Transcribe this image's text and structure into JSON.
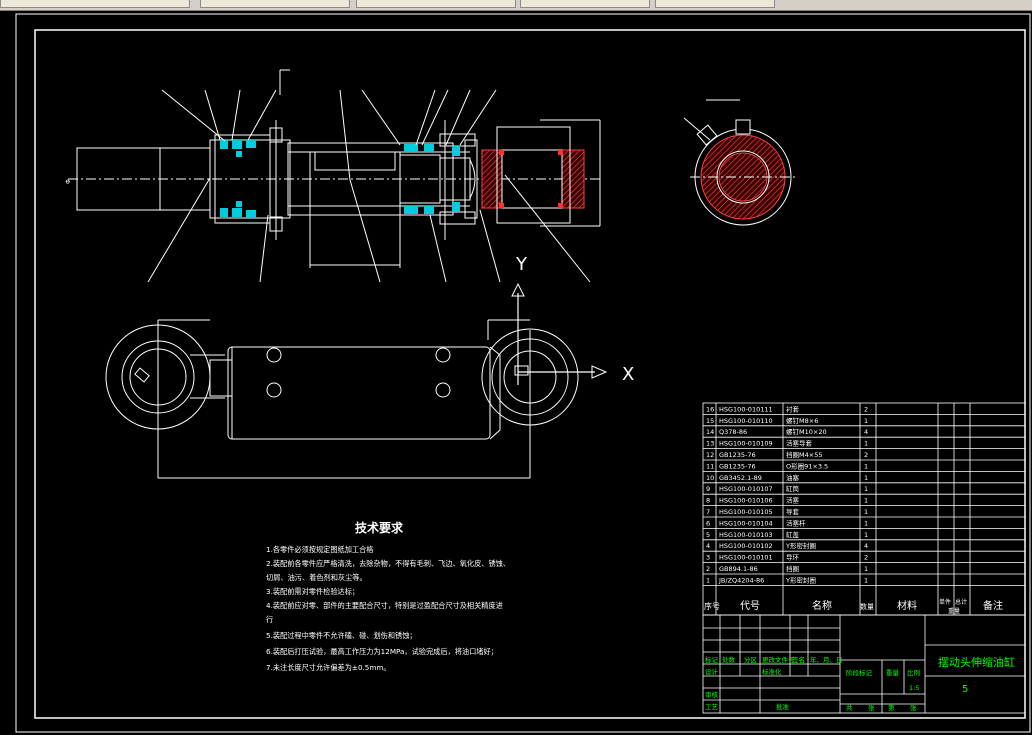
{
  "app": {
    "toolbar_tabs": [
      "",
      "",
      "",
      "",
      ""
    ]
  },
  "drawing": {
    "axis_y_label": "Y",
    "axis_x_label": "X",
    "tech_title": "技术要求",
    "tech_notes": [
      "1.各零件必须按规定图纸加工合格",
      "2.装配前各零件应严格清洗，去除杂物，不得有毛刺、飞边、氧化皮、锈蚀、",
      "  切屑、油污、着色剂和灰尘等。",
      "3.装配前需对零件检验达标；",
      "4.装配前应对零、部件的主要配合尺寸，特别是过盈配合尺寸及相关精度进",
      "  行",
      "5.装配过程中零件不允许磕、碰、划伤和锈蚀；",
      "6.装配后打压试验，最高工作压力为12MPa，试验完成后，将油口堵好；",
      "7.未注长度尺寸允许偏差为±0.5mm。"
    ],
    "bom_rows": [
      {
        "no": "16",
        "code": "HSG100-010111",
        "name": "衬套",
        "qty": "2"
      },
      {
        "no": "15",
        "code": "HSG100-010110",
        "name": "螺钉M8×6",
        "qty": "1"
      },
      {
        "no": "14",
        "code": "Q378-86",
        "name": "螺钉M10×20",
        "qty": "4"
      },
      {
        "no": "13",
        "code": "HSG100-010109",
        "name": "活塞导套",
        "qty": "1"
      },
      {
        "no": "12",
        "code": "GB1235-76",
        "name": "挡圈M4×55",
        "qty": "2"
      },
      {
        "no": "11",
        "code": "GB1235-76",
        "name": "O形圈91×3.5",
        "qty": "1"
      },
      {
        "no": "10",
        "code": "GB3452.1-89",
        "name": "油塞",
        "qty": "1"
      },
      {
        "no": "9",
        "code": "HSG100-010107",
        "name": "缸筒",
        "qty": "1"
      },
      {
        "no": "8",
        "code": "HSG100-010106",
        "name": "活塞",
        "qty": "1"
      },
      {
        "no": "7",
        "code": "HSG100-010105",
        "name": "导套",
        "qty": "1"
      },
      {
        "no": "6",
        "code": "HSG100-010104",
        "name": "活塞杆",
        "qty": "1"
      },
      {
        "no": "5",
        "code": "HSG100-010103",
        "name": "缸盖",
        "qty": "1"
      },
      {
        "no": "4",
        "code": "HSG100-010102",
        "name": "Y形密封圈",
        "qty": "4"
      },
      {
        "no": "3",
        "code": "HSG100-010101",
        "name": "导环",
        "qty": "2"
      },
      {
        "no": "2",
        "code": "GB894.1-86",
        "name": "挡圈",
        "qty": "1"
      },
      {
        "no": "1",
        "code": "JB/ZQ4204-86",
        "name": "Y形密封圈",
        "qty": "1"
      }
    ],
    "bom_header": {
      "no": "序号",
      "code": "代号",
      "name": "名称",
      "qty": "数量",
      "material": "材料",
      "single": "单件",
      "total": "总计",
      "weight": "重量",
      "remark": "备注"
    },
    "title_block": {
      "drawing_title": "摆动头伸缩油缸",
      "sheet_no": "5",
      "scale_value": "1:5",
      "labels": [
        "标记",
        "处数",
        "分区",
        "更改文件号",
        "签名",
        "年、月、日",
        "设计",
        "标准化",
        "阶段标记",
        "重量",
        "比例",
        "审核",
        "工艺",
        "批准",
        "共",
        "张",
        "第",
        "张"
      ]
    }
  }
}
